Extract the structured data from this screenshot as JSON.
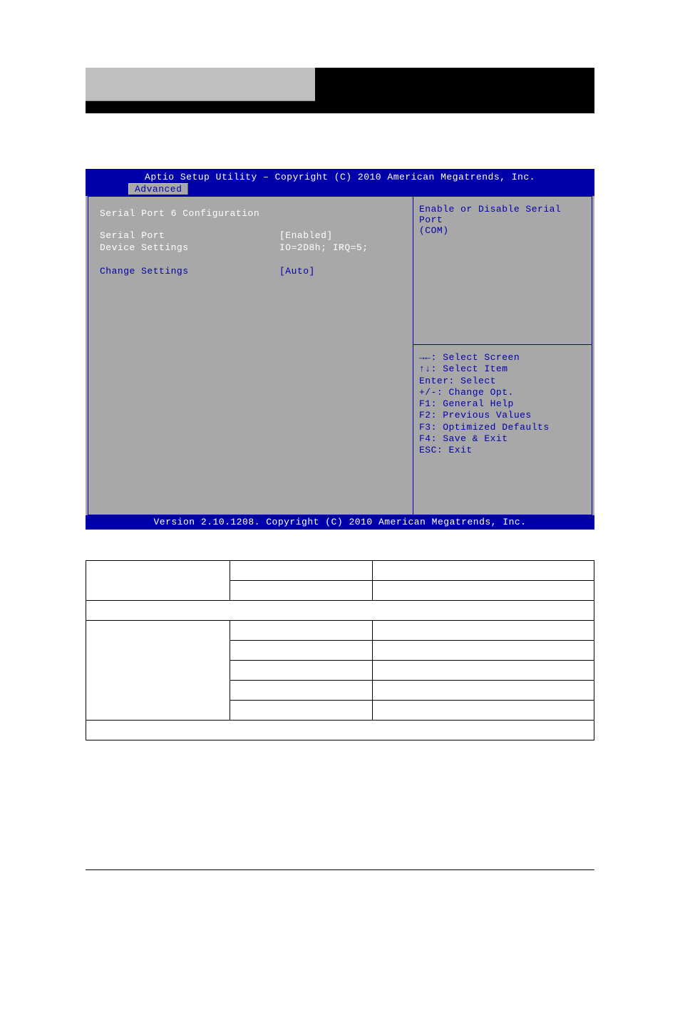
{
  "header": {},
  "bios": {
    "title": "Aptio Setup Utility – Copyright (C) 2010 American Megatrends, Inc.",
    "tab": "Advanced",
    "heading": "Serial Port 6 Configuration",
    "rows": {
      "serialPort": {
        "label": "Serial Port",
        "value": "[Enabled]"
      },
      "deviceSettings": {
        "label": "Device Settings",
        "value": "IO=2D8h; IRQ=5;"
      },
      "changeSettings": {
        "label": "Change Settings",
        "value": "[Auto]"
      }
    },
    "help1": "Enable or Disable Serial Port",
    "help2": "(COM)",
    "keys": {
      "k1": "→←: Select Screen",
      "k2": "↑↓: Select Item",
      "k3": "Enter: Select",
      "k4": "+/-: Change Opt.",
      "k5": "F1: General Help",
      "k6": "F2: Previous Values",
      "k7": "F3: Optimized Defaults",
      "k8": "F4: Save & Exit",
      "k9": "ESC: Exit"
    },
    "footer": "Version 2.10.1208. Copyright (C) 2010 American Megatrends, Inc."
  },
  "table": {
    "r1c1": "",
    "r1c2a": "",
    "r1c2b": "",
    "r1c3a": "",
    "r1c3b": "",
    "span1": "",
    "r3c1": "",
    "r3_opts": [
      "",
      "",
      "",
      "",
      ""
    ],
    "r3_desc": [
      "",
      "",
      "",
      "",
      ""
    ],
    "span2": ""
  }
}
